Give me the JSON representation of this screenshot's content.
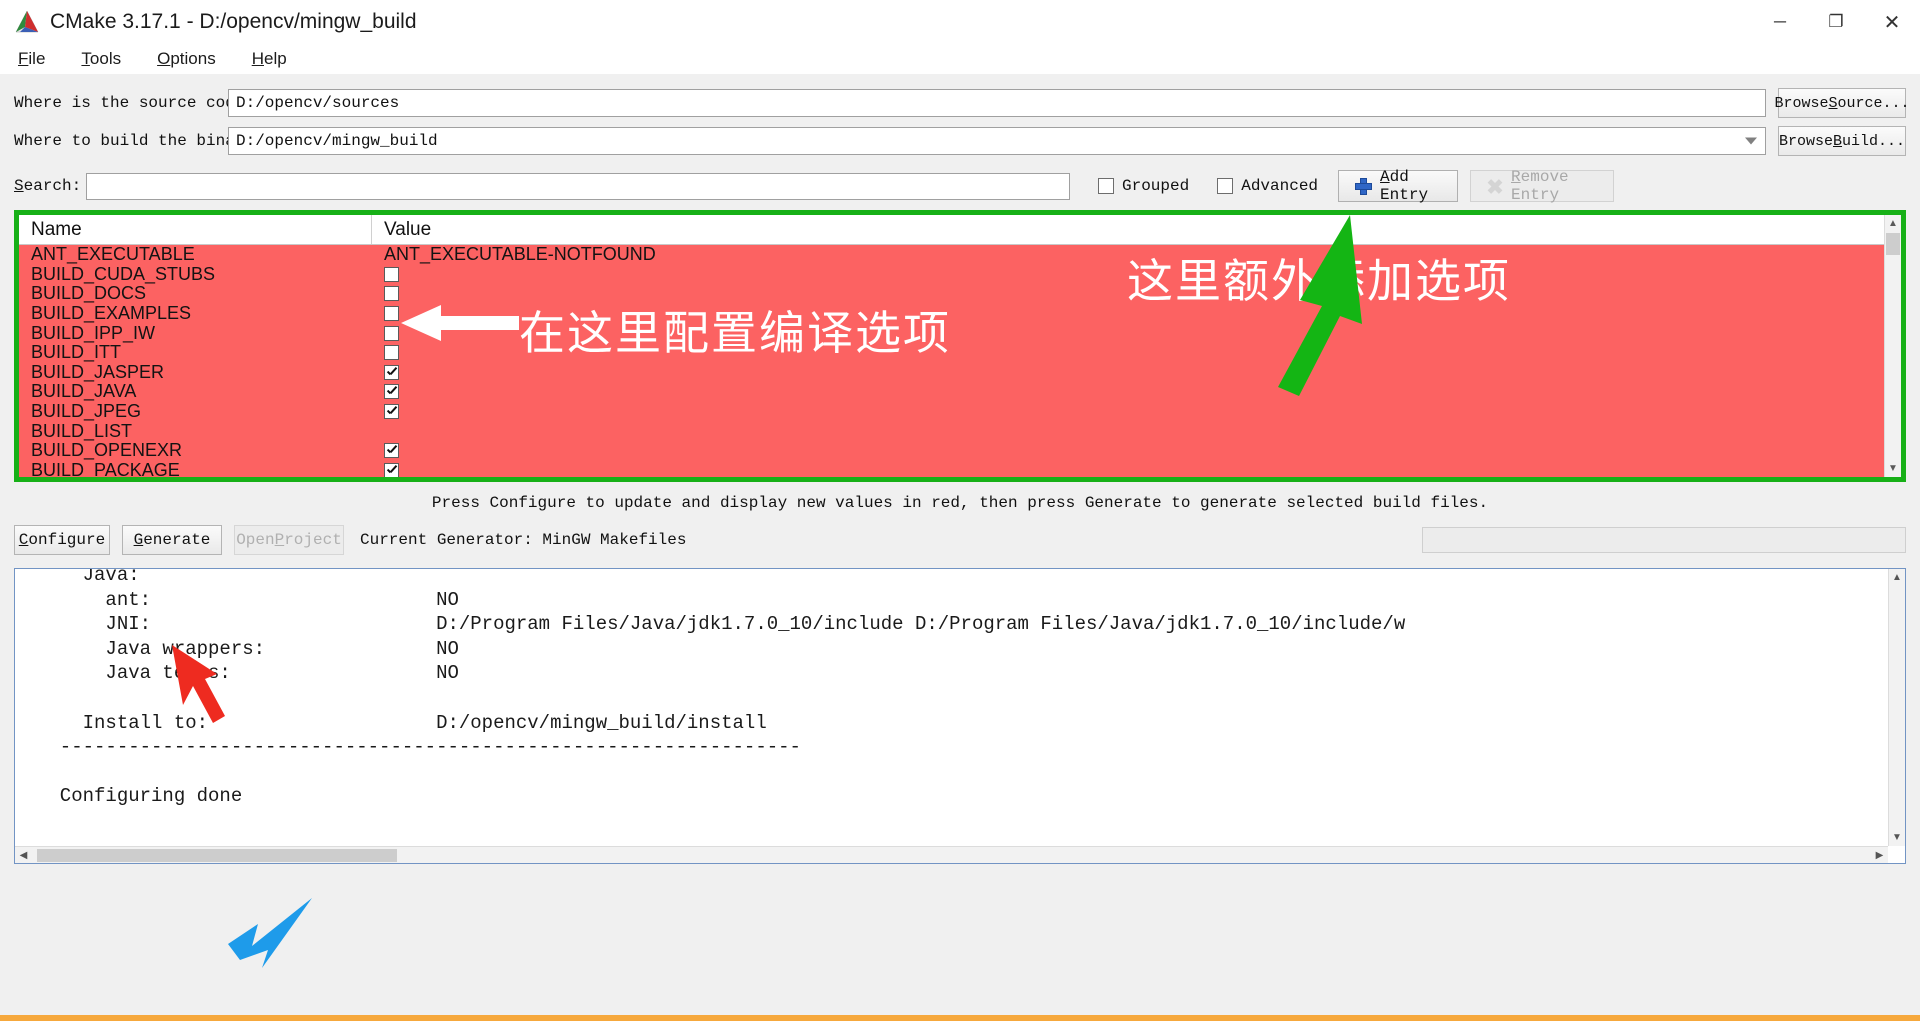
{
  "window": {
    "title": "CMake 3.17.1 - D:/opencv/mingw_build",
    "icon": "cmake-logo-icon",
    "minimize": "─",
    "maximize": "❐",
    "close": "✕"
  },
  "menubar": [
    {
      "label": "File",
      "mnemonic": "F"
    },
    {
      "label": "Tools",
      "mnemonic": "T"
    },
    {
      "label": "Options",
      "mnemonic": "O"
    },
    {
      "label": "Help",
      "mnemonic": "H"
    }
  ],
  "form": {
    "source_label": "Where is the source code:",
    "source_value": "D:/opencv/sources",
    "browse_source": "Browse Source...",
    "build_label": "Where to build the binaries:",
    "build_value": "D:/opencv/mingw_build",
    "browse_build": "Browse Build...",
    "search_label": "Search:",
    "search_value": "",
    "grouped_label": "Grouped",
    "grouped_checked": false,
    "advanced_label": "Advanced",
    "advanced_checked": false,
    "add_entry": "Add Entry",
    "remove_entry": "Remove Entry",
    "remove_entry_enabled": false
  },
  "cache_table": {
    "columns": [
      "Name",
      "Value"
    ],
    "rows": [
      {
        "name": "ANT_EXECUTABLE",
        "type": "string",
        "value": "ANT_EXECUTABLE-NOTFOUND"
      },
      {
        "name": "BUILD_CUDA_STUBS",
        "type": "checkbox",
        "checked": false
      },
      {
        "name": "BUILD_DOCS",
        "type": "checkbox",
        "checked": false
      },
      {
        "name": "BUILD_EXAMPLES",
        "type": "checkbox",
        "checked": false
      },
      {
        "name": "BUILD_IPP_IW",
        "type": "checkbox",
        "checked": false
      },
      {
        "name": "BUILD_ITT",
        "type": "checkbox",
        "checked": false
      },
      {
        "name": "BUILD_JASPER",
        "type": "checkbox",
        "checked": true
      },
      {
        "name": "BUILD_JAVA",
        "type": "checkbox",
        "checked": true
      },
      {
        "name": "BUILD_JPEG",
        "type": "checkbox",
        "checked": true
      },
      {
        "name": "BUILD_LIST",
        "type": "string",
        "value": ""
      },
      {
        "name": "BUILD_OPENEXR",
        "type": "checkbox",
        "checked": true
      },
      {
        "name": "BUILD_PACKAGE",
        "type": "checkbox",
        "checked": true
      }
    ],
    "row_highlight_color": "#fc6262",
    "border_highlight_color": "#17b017"
  },
  "annotations": {
    "configure_options": "在这里配置编译选项",
    "add_option": "这里额外添加选项",
    "white_arrow": "left-arrow-icon",
    "green_arrow": "green-arrow-icon",
    "red_arrow": "red-arrow-icon",
    "blue_arrow": "blue-arrow-icon"
  },
  "status": {
    "hint": "Press Configure to update and display new values in red, then press Generate to generate selected build files."
  },
  "actions": {
    "configure": "Configure",
    "generate": "Generate",
    "open_project": "Open Project",
    "open_project_enabled": false,
    "generator_text": "Current Generator: MinGW Makefiles",
    "progress": ""
  },
  "log": {
    "lines": "    Java:\n      ant:                         NO\n      JNI:                         D:/Program Files/Java/jdk1.7.0_10/include D:/Program Files/Java/jdk1.7.0_10/include/w\n      Java wrappers:               NO\n      Java tests:                  NO\n\n    Install to:                    D:/opencv/mingw_build/install\n  -----------------------------------------------------------------\n\n  Configuring done"
  },
  "scrollbars": {
    "up_arrow": "▲",
    "down_arrow": "▼",
    "left_arrow": "◀",
    "right_arrow": "▶"
  }
}
